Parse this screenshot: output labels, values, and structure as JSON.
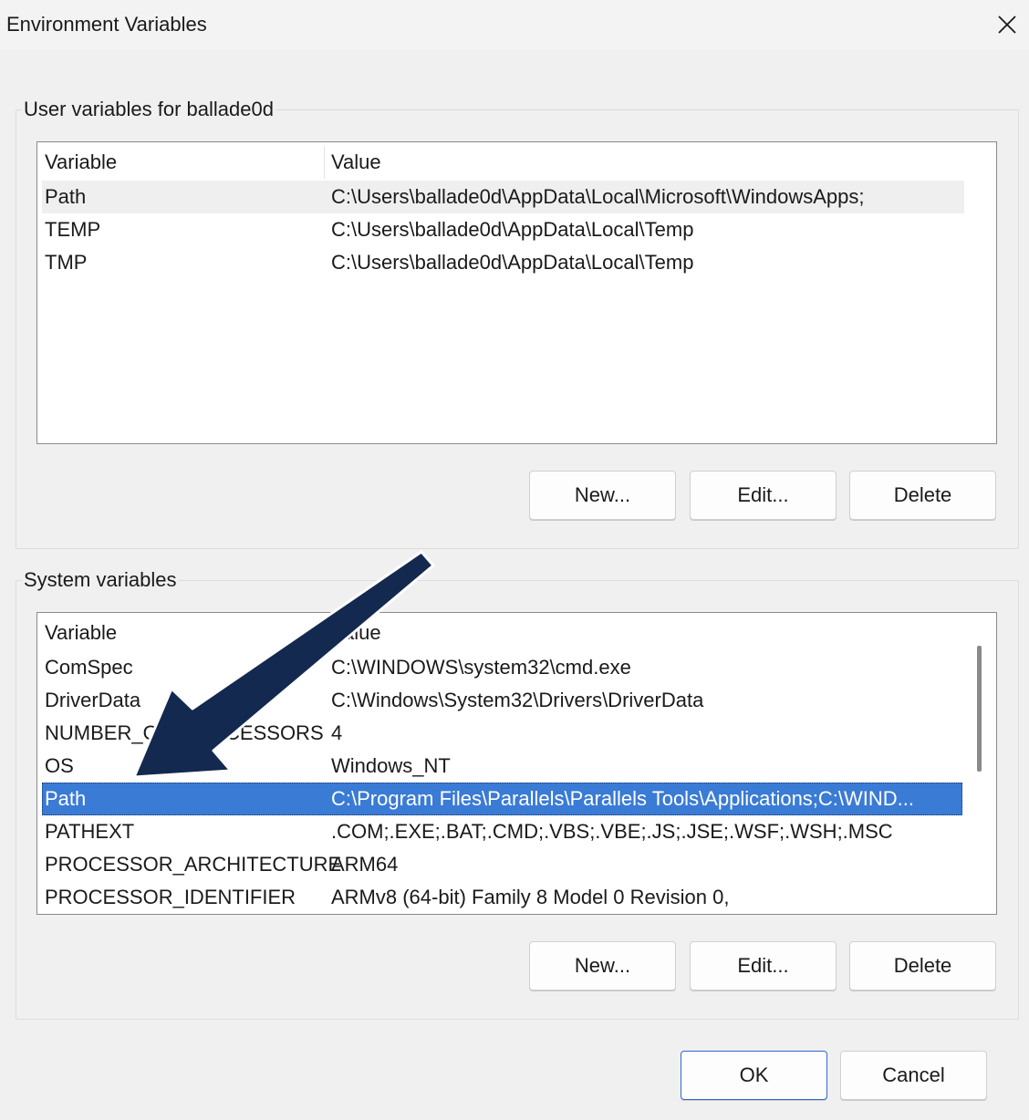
{
  "window": {
    "title": "Environment Variables"
  },
  "user_vars": {
    "label": "User variables for ballade0d",
    "header": {
      "variable": "Variable",
      "value": "Value"
    },
    "rows": [
      {
        "variable": "Path",
        "value": "C:\\Users\\ballade0d\\AppData\\Local\\Microsoft\\WindowsApps;"
      },
      {
        "variable": "TEMP",
        "value": "C:\\Users\\ballade0d\\AppData\\Local\\Temp"
      },
      {
        "variable": "TMP",
        "value": "C:\\Users\\ballade0d\\AppData\\Local\\Temp"
      }
    ],
    "buttons": {
      "new": "New...",
      "edit": "Edit...",
      "delete": "Delete"
    }
  },
  "system_vars": {
    "label": "System variables",
    "header": {
      "variable": "Variable",
      "value": "Value"
    },
    "rows": [
      {
        "variable": "ComSpec",
        "value": "C:\\WINDOWS\\system32\\cmd.exe"
      },
      {
        "variable": "DriverData",
        "value": "C:\\Windows\\System32\\Drivers\\DriverData"
      },
      {
        "variable": "NUMBER_OF_PROCESSORS",
        "value": "4"
      },
      {
        "variable": "OS",
        "value": "Windows_NT"
      },
      {
        "variable": "Path",
        "value": "C:\\Program Files\\Parallels\\Parallels Tools\\Applications;C:\\WIND..."
      },
      {
        "variable": "PATHEXT",
        "value": ".COM;.EXE;.BAT;.CMD;.VBS;.VBE;.JS;.JSE;.WSF;.WSH;.MSC"
      },
      {
        "variable": "PROCESSOR_ARCHITECTURE",
        "value": "ARM64"
      },
      {
        "variable": "PROCESSOR_IDENTIFIER",
        "value": "ARMv8 (64-bit) Family 8 Model 0 Revision   0,"
      }
    ],
    "selected": "Path",
    "buttons": {
      "new": "New...",
      "edit": "Edit...",
      "delete": "Delete"
    }
  },
  "footer": {
    "ok": "OK",
    "cancel": "Cancel"
  },
  "colors": {
    "selection": "#3a7bd5",
    "arrow": "#14294f",
    "default_border": "#2f6ac8"
  },
  "icons": {
    "close": "close-icon",
    "annotation": "arrow-annotation"
  }
}
